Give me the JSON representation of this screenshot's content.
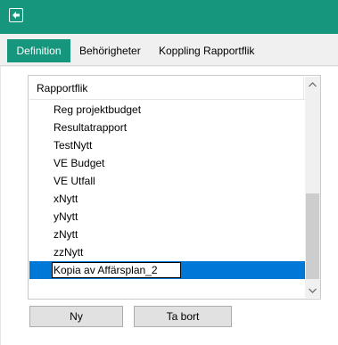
{
  "tabs": [
    {
      "label": "Definition",
      "active": true
    },
    {
      "label": "Behörigheter",
      "active": false
    },
    {
      "label": "Koppling Rapportflik",
      "active": false
    }
  ],
  "list": {
    "header": "Rapportflik",
    "items": [
      "Reg projektbudget",
      "Resultatrapport",
      "TestNytt",
      "VE Budget",
      "VE Utfall",
      "xNytt",
      "yNytt",
      "zNytt",
      "zzNytt"
    ],
    "editing_value": "Kopia av Affärsplan_2"
  },
  "buttons": {
    "new_label": "Ny",
    "delete_label": "Ta bort"
  },
  "colors": {
    "accent": "#16967d",
    "selection": "#0078d7"
  },
  "icons": {
    "app": "app-icon",
    "scroll_up": "chevron-up-icon",
    "scroll_down": "chevron-down-icon"
  }
}
